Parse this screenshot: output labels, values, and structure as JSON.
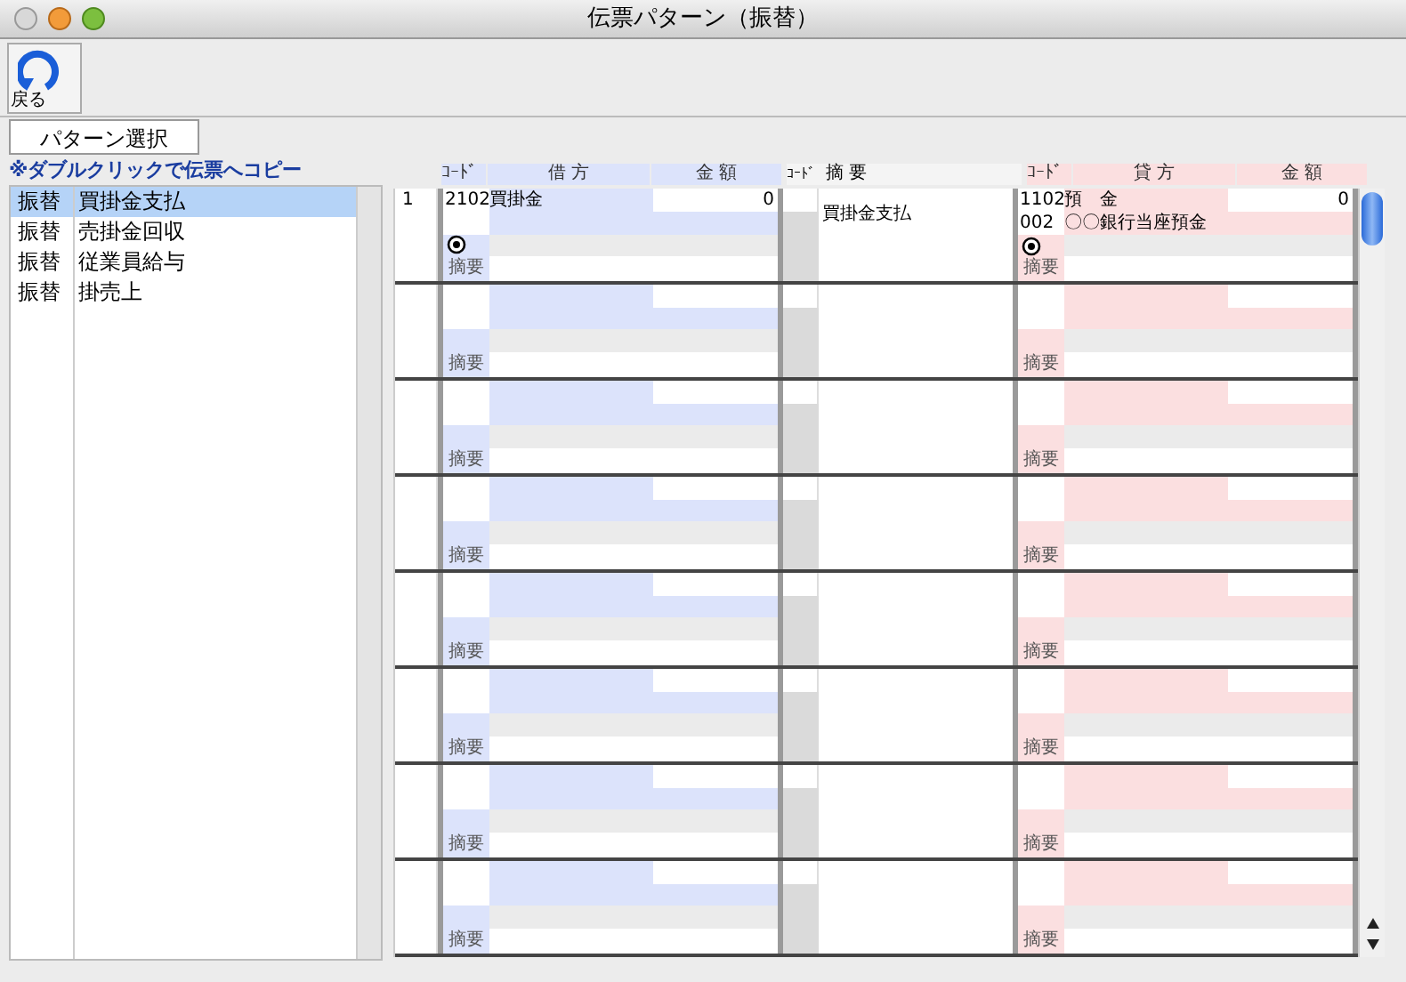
{
  "window": {
    "title": "伝票パターン（振替）"
  },
  "toolbar": {
    "back_button": "戻る"
  },
  "pattern_tab": {
    "label": "パターン選択",
    "selected": true
  },
  "instruction": "※ダブルクリックで伝票へコピー",
  "patterns": [
    {
      "type": "振替",
      "name": "買掛金支払",
      "selected": true
    },
    {
      "type": "振替",
      "name": "売掛金回収",
      "selected": false
    },
    {
      "type": "振替",
      "name": "従業員給与",
      "selected": false
    },
    {
      "type": "振替",
      "name": "掛売上",
      "selected": false
    }
  ],
  "columns": [
    "ｺｰﾄﾞ",
    "借 方",
    "金 額",
    "ｺｰﾄﾞ",
    "摘 要",
    "ｺｰﾄﾞ",
    "貸 方",
    "金 額"
  ],
  "entries": [
    {
      "number": "1",
      "debit": {
        "code": "2102",
        "account": "買掛金",
        "amount": "0",
        "radio_selected": true,
        "memo_label": "摘要"
      },
      "memo": "買掛金支払",
      "credit": {
        "code": "1102",
        "account": "預　金",
        "amount": "0",
        "sub_code": "002",
        "sub_account": "〇〇銀行当座預金",
        "radio_selected": true,
        "memo_label": "摘要"
      }
    },
    {
      "debit": {
        "memo_label": "摘要"
      },
      "credit": {
        "memo_label": "摘要"
      }
    },
    {
      "debit": {
        "memo_label": "摘要"
      },
      "credit": {
        "memo_label": "摘要"
      }
    },
    {
      "debit": {
        "memo_label": "摘要"
      },
      "credit": {
        "memo_label": "摘要"
      }
    },
    {
      "debit": {
        "memo_label": "摘要"
      },
      "credit": {
        "memo_label": "摘要"
      }
    },
    {
      "debit": {
        "memo_label": "摘要"
      },
      "credit": {
        "memo_label": "摘要"
      }
    },
    {
      "debit": {
        "memo_label": "摘要"
      },
      "credit": {
        "memo_label": "摘要"
      }
    },
    {
      "debit": {
        "memo_label": "摘要"
      },
      "credit": {
        "memo_label": "摘要"
      }
    }
  ]
}
